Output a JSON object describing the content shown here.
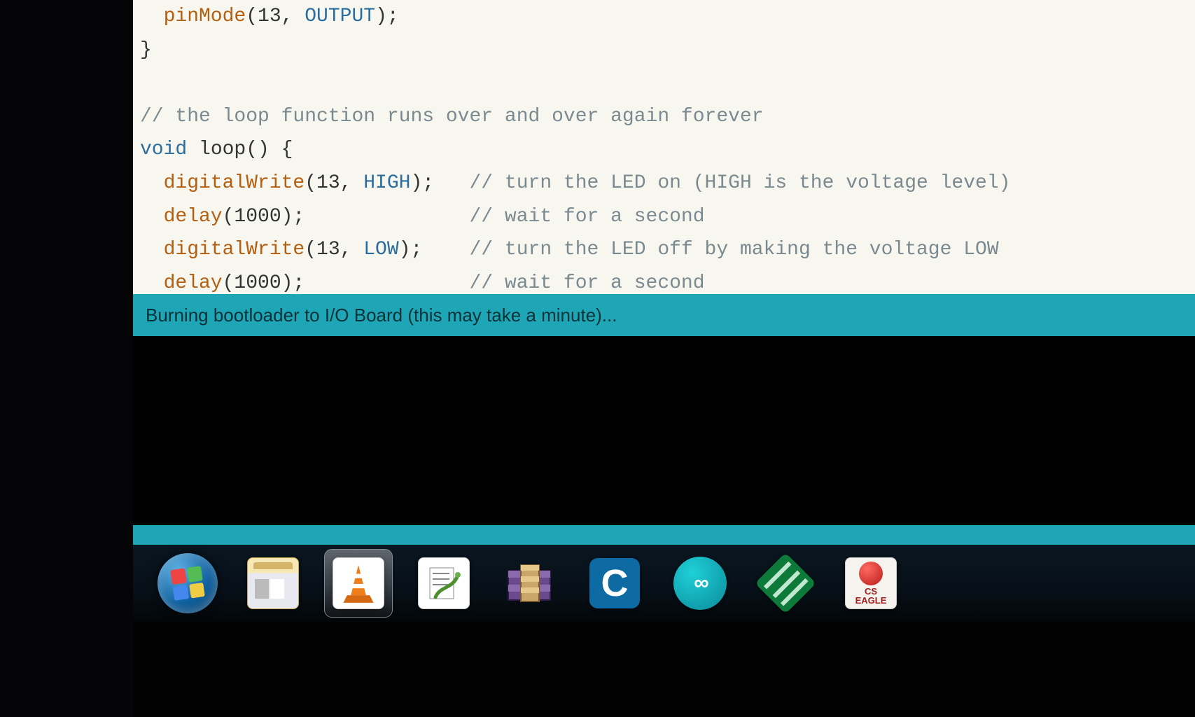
{
  "code": {
    "l1_fn": "pinMode",
    "l1_args_open": "(",
    "l1_arg1": "13",
    "l1_sep": ", ",
    "l1_const": "OUTPUT",
    "l1_close": ");",
    "l2": "}",
    "l4_comment": "// the loop function runs over and over again forever",
    "l5_kw": "void",
    "l5_fn": " loop",
    "l5_rest": "() {",
    "l6_fn": "digitalWrite",
    "l6_args": "(13, ",
    "l6_const": "HIGH",
    "l6_close": ");",
    "l6_pad": "   ",
    "l6_comment": "// turn the LED on (HIGH is the voltage level)",
    "l7_fn": "delay",
    "l7_args": "(1000);",
    "l7_pad": "              ",
    "l7_comment": "// wait for a second",
    "l8_fn": "digitalWrite",
    "l8_args": "(13, ",
    "l8_const": "LOW",
    "l8_close": ");",
    "l8_pad": "    ",
    "l8_comment": "// turn the LED off by making the voltage LOW",
    "l9_fn": "delay",
    "l9_args": "(1000);",
    "l9_pad": "              ",
    "l9_comment": "// wait for a second"
  },
  "status": {
    "message": "Burning bootloader to I/O Board (this may take a minute)..."
  },
  "taskbar": {
    "start": "Start",
    "ccleaner_letter": "C",
    "arduino_infinity": "∞",
    "eagle_small": "CS",
    "eagle_label": "EAGLE"
  }
}
